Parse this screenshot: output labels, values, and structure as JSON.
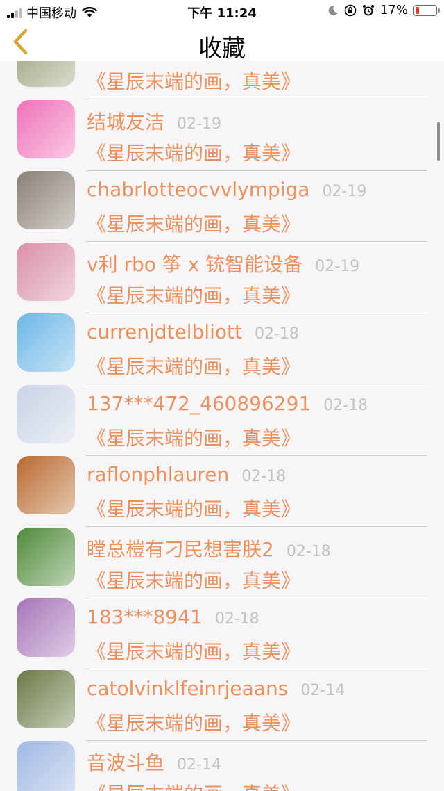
{
  "status_bar": {
    "carrier": "中国移动",
    "time": "下午 11:24",
    "battery": "17%",
    "battery_level": 0.17
  },
  "nav": {
    "title": "收藏"
  },
  "rows": [
    {
      "name": "",
      "date": "",
      "title": "《星辰末端的画，真美》",
      "avatar_color": "#9aa07a"
    },
    {
      "name": "结城友洁",
      "date": "02-19",
      "title": "《星辰末端的画，真美》",
      "avatar_color": "#f070b8"
    },
    {
      "name": "chabrlotteocvvlympiga",
      "date": "02-19",
      "title": "《星辰末端的画，真美》",
      "avatar_color": "#8a7f74"
    },
    {
      "name": "v利 rbo 筝 x 铳智能设备",
      "date": "02-19",
      "title": "《星辰末端的画，真美》",
      "avatar_color": "#d98fa7"
    },
    {
      "name": "currenjdtelbliott",
      "date": "02-18",
      "title": "《星辰末端的画，真美》",
      "avatar_color": "#6cb6e6"
    },
    {
      "name": "137***472_460896291",
      "date": "02-18",
      "title": "《星辰末端的画，真美》",
      "avatar_color": "#c9d3e6"
    },
    {
      "name": "raflonphlauren",
      "date": "02-18",
      "title": "《星辰末端的画，真美》",
      "avatar_color": "#b9692e"
    },
    {
      "name": "瞠总榿有刁民想害朕2",
      "date": "02-18",
      "title": "《星辰末端的画，真美》",
      "avatar_color": "#4f8a3a"
    },
    {
      "name": "183***8941",
      "date": "02-18",
      "title": "《星辰末端的画，真美》",
      "avatar_color": "#a775b8"
    },
    {
      "name": "catolvinklfeinrjeaans",
      "date": "02-14",
      "title": "《星辰末端的画，真美》",
      "avatar_color": "#6a7a45"
    },
    {
      "name": "音波斗鱼",
      "date": "02-14",
      "title": "《星辰末端的画，真美》",
      "avatar_color": "#9fb8e4"
    }
  ]
}
